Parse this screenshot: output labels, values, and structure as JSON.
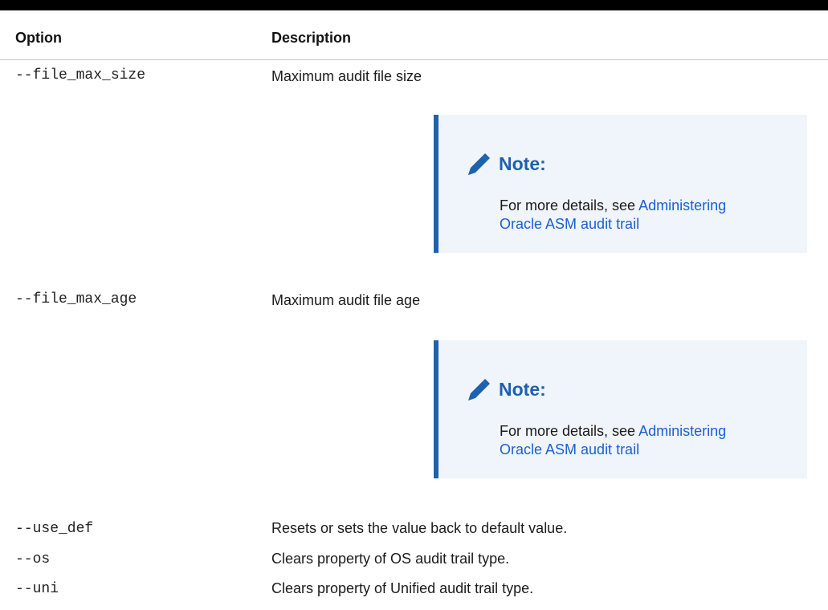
{
  "table": {
    "headers": {
      "option": "Option",
      "description": "Description"
    },
    "rows": [
      {
        "option": "--file_max_size",
        "description": "Maximum audit file size",
        "note": {
          "title": "Note:",
          "text_prefix": "For more details, see ",
          "link_text_line1": "Administering",
          "link_text_line2": "Oracle ASM audit trail"
        }
      },
      {
        "option": "--file_max_age",
        "description": "Maximum audit file age",
        "note": {
          "title": "Note:",
          "text_prefix": "For more details, see ",
          "link_text_line1": "Administering",
          "link_text_line2": "Oracle ASM audit trail"
        }
      },
      {
        "option": "--use_def",
        "description": "Resets or sets the value back to default value."
      },
      {
        "option": "--os",
        "description": "Clears property of OS audit trail type."
      },
      {
        "option": "--uni",
        "description": "Clears property of Unified audit trail type."
      }
    ]
  },
  "colors": {
    "note_accent": "#1c62ae",
    "note_background": "#f0f4fb",
    "link": "#1a5fd2"
  },
  "icons": {
    "note": "pencil-icon"
  }
}
